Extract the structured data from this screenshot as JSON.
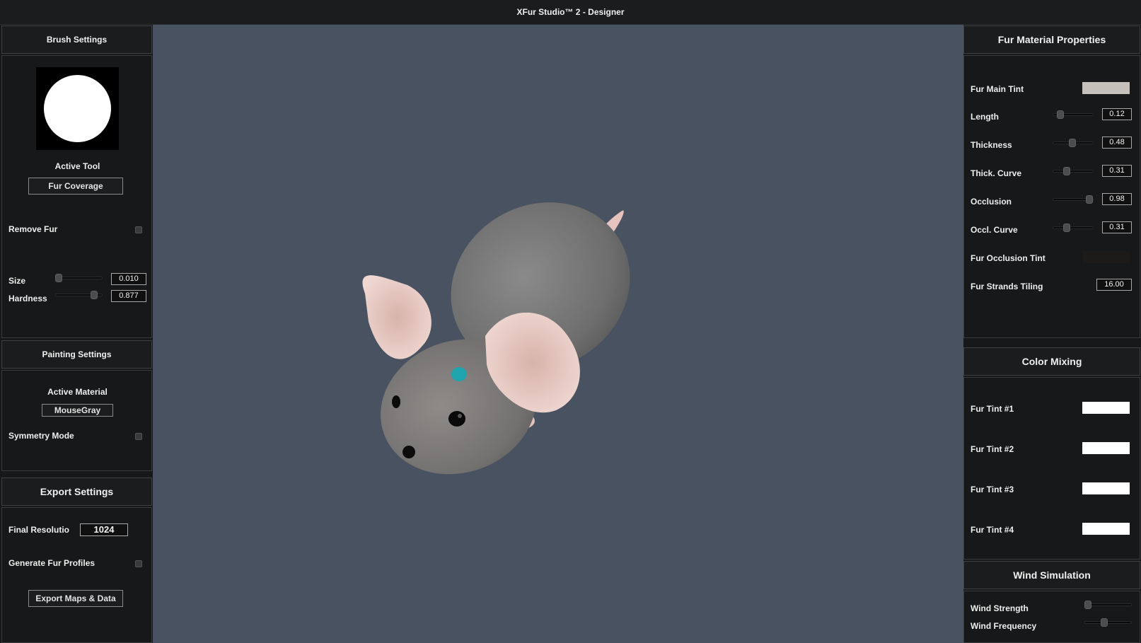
{
  "window": {
    "title": "XFur Studio™ 2 - Designer"
  },
  "brush_settings": {
    "header": "Brush Settings",
    "active_tool_label": "Active Tool",
    "active_tool_value": "Fur Coverage",
    "remove_fur_label": "Remove Fur",
    "size_label": "Size",
    "size_value": "0.010",
    "size_level": 0.0,
    "hardness_label": "Hardness",
    "hardness_value": "0.877",
    "hardness_level": 0.877
  },
  "painting_settings": {
    "header": "Painting Settings",
    "active_material_label": "Active Material",
    "active_material_value": "MouseGray",
    "symmetry_label": "Symmetry Mode"
  },
  "export_settings": {
    "header": "Export Settings",
    "final_resolution_label": "Final Resolutio",
    "final_resolution_value": "1024",
    "generate_profiles_label": "Generate Fur Profiles",
    "export_button": "Export Maps & Data"
  },
  "fur_material": {
    "header": "Fur Material Properties",
    "main_tint_label": "Fur Main Tint",
    "main_tint_color": "#c6c0bb",
    "props": [
      {
        "label": "Length",
        "value": "0.12",
        "level": 0.12
      },
      {
        "label": "Thickness",
        "value": "0.48",
        "level": 0.48
      },
      {
        "label": "Thick. Curve",
        "value": "0.31",
        "level": 0.31
      },
      {
        "label": "Occlusion",
        "value": "0.98",
        "level": 0.98
      },
      {
        "label": "Occl. Curve",
        "value": "0.31",
        "level": 0.31
      }
    ],
    "occlusion_tint_label": "Fur Occlusion Tint",
    "occlusion_tint_color": "#1c1b1a",
    "strands_tiling_label": "Fur Strands Tiling",
    "strands_tiling_value": "16.00"
  },
  "color_mixing": {
    "header": "Color Mixing",
    "tints": [
      {
        "label": "Fur Tint #1",
        "color": "#ffffff"
      },
      {
        "label": "Fur Tint #2",
        "color": "#ffffff"
      },
      {
        "label": "Fur Tint #3",
        "color": "#ffffff"
      },
      {
        "label": "Fur Tint #4",
        "color": "#ffffff"
      }
    ]
  },
  "wind_simulation": {
    "header": "Wind Simulation",
    "strength_label": "Wind Strength",
    "strength_level": 0.0,
    "frequency_label": "Wind Frequency",
    "frequency_level": 0.4
  },
  "colors": {
    "viewport_bg": "#495260",
    "panel_bg": "#171819",
    "paint_spot": "#1fa3ad",
    "fur_gray": "#7a7a7a",
    "ear_pink": "#e6c4bd"
  }
}
